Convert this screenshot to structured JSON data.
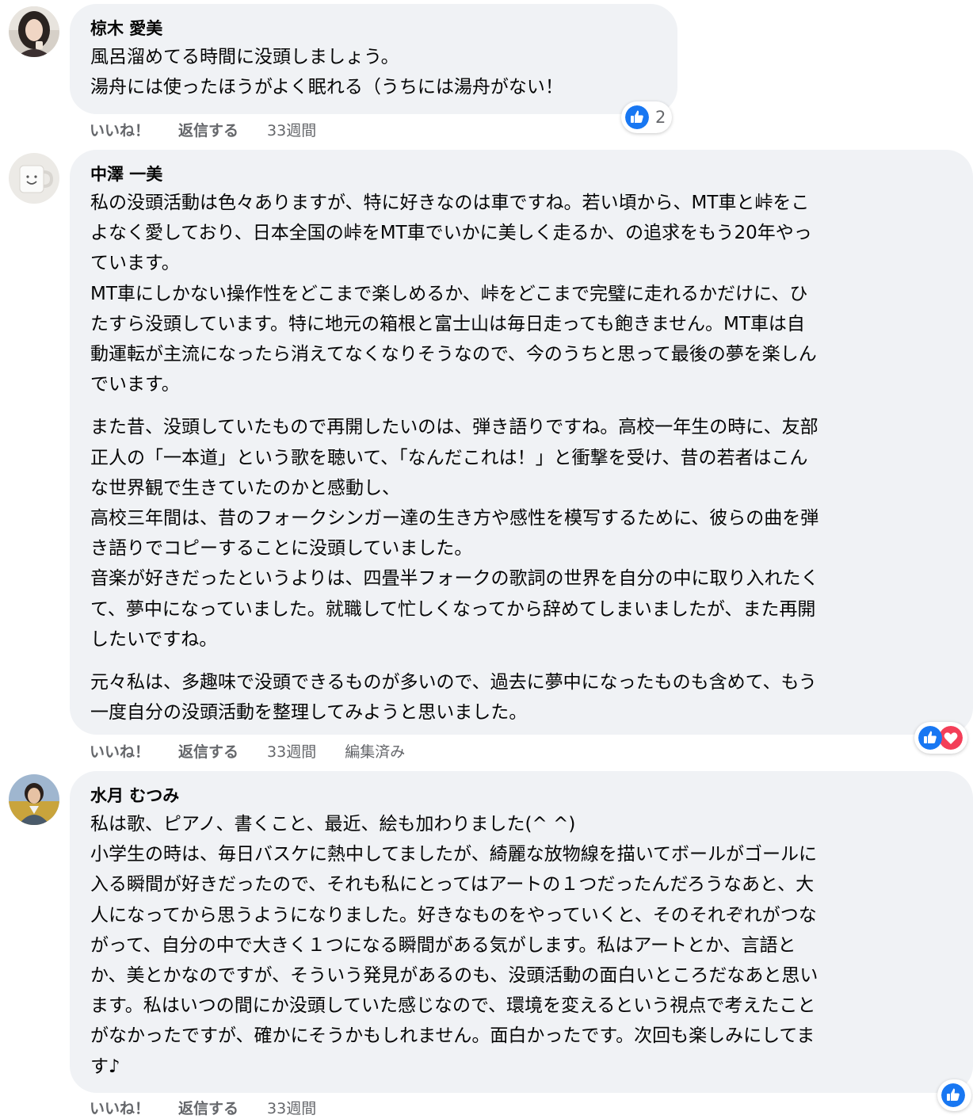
{
  "comments": [
    {
      "author": "椋木 愛美",
      "paragraphs": [
        [
          "風呂溜めてる時間に没頭しましょう。",
          "湯舟には使ったほうがよく眠れる（うちには湯舟がない！"
        ]
      ],
      "actions": {
        "like": "いいね！",
        "reply": "返信する",
        "time": "33週間"
      },
      "reactions": {
        "icons": [
          "like-icon"
        ],
        "count": "2"
      }
    },
    {
      "author": "中澤 一美",
      "paragraphs": [
        [
          "私の没頭活動は色々ありますが、特に好きなのは車ですね。若い頃から、MT車と峠をこ",
          "よなく愛しており、日本全国の峠をMT車でいかに美しく走るか、の追求をもう20年やっ",
          "ています。",
          "MT車にしかない操作性をどこまで楽しめるか、峠をどこまで完璧に走れるかだけに、ひ",
          "たすら没頭しています。特に地元の箱根と富士山は毎日走っても飽きません。MT車は自",
          "動運転が主流になったら消えてなくなりそうなので、今のうちと思って最後の夢を楽しん",
          "でいます。"
        ],
        [
          "また昔、没頭していたもので再開したいのは、弾き語りですね。高校一年生の時に、友部",
          "正人の「一本道」という歌を聴いて、「なんだこれは！」と衝撃を受け、昔の若者はこん",
          "な世界観で生きていたのかと感動し、",
          "高校三年間は、昔のフォークシンガー達の生き方や感性を模写するために、彼らの曲を弾",
          "き語りでコピーすることに没頭していました。",
          "音楽が好きだったというよりは、四畳半フォークの歌詞の世界を自分の中に取り入れたく",
          "て、夢中になっていました。就職して忙しくなってから辞めてしまいましたが、また再開",
          "したいですね。"
        ],
        [
          "元々私は、多趣味で没頭できるものが多いので、過去に夢中になったものも含めて、もう",
          "一度自分の没頭活動を整理してみようと思いました。"
        ]
      ],
      "actions": {
        "like": "いいね！",
        "reply": "返信する",
        "time": "33週間",
        "edited": "編集済み"
      },
      "reactions": {
        "icons": [
          "like-icon",
          "love-icon"
        ],
        "count": ""
      }
    },
    {
      "author": "水月 むつみ",
      "paragraphs": [
        [
          "私は歌、ピアノ、書くこと、最近、絵も加わりました(^ ^)",
          "小学生の時は、毎日バスケに熱中してましたが、綺麗な放物線を描いてボールがゴールに",
          "入る瞬間が好きだったので、それも私にとってはアートの１つだったんだろうなあと、大",
          "人になってから思うようになりました。好きなものをやっていくと、そのそれぞれがつな",
          "がって、自分の中で大きく１つになる瞬間がある気がします。私はアートとか、言語と",
          "か、美とかなのですが、そういう発見があるのも、没頭活動の面白いところだなあと思い",
          "ます。私はいつの間にか没頭していた感じなので、環境を変えるという視点で考えたこと",
          "がなかったですが、確かにそうかもしれません。面白かったです。次回も楽しみにしてま",
          "す♪"
        ]
      ],
      "actions": {
        "like": "いいね！",
        "reply": "返信する",
        "time": "33週間"
      },
      "reactions": {
        "icons": [
          "like-icon"
        ],
        "count": ""
      }
    }
  ],
  "colors": {
    "bubble": "#f0f2f5",
    "text": "#050505",
    "secondary": "#65676b",
    "like": "#1877f2",
    "love": "#f33e58"
  }
}
